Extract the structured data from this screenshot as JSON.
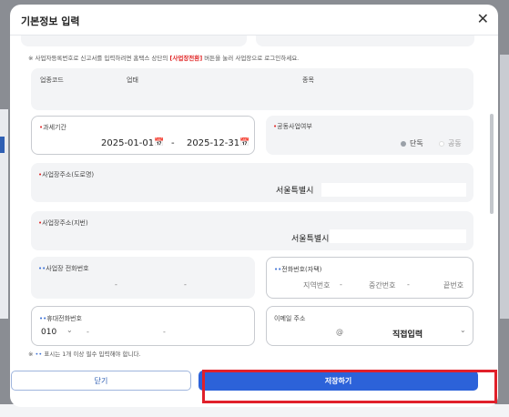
{
  "header": {
    "title": "기본정보 입력",
    "close_symbol": "✕"
  },
  "top_partial": {
    "left_value": "",
    "right_value": ""
  },
  "notice": {
    "prefix": "※ 사업자등록번호로 신고서를 입력하려면 홈택스 상단의 ",
    "highlight": "[사업장전환]",
    "suffix": " 버튼을 눌러 사업장으로 로그인하세요."
  },
  "business_info": {
    "code_label": "업종코드",
    "type_label": "업태",
    "item_label": "종목"
  },
  "tax_period": {
    "marker": "•",
    "label": "과세기간",
    "start": "2025-01-01",
    "separator": "-",
    "end": "2025-12-31",
    "calendar_icon": "calendar-icon"
  },
  "joint_business": {
    "marker": "•",
    "label": "공동사업여부",
    "option1": "단독",
    "option2": "공동",
    "selected": "단독"
  },
  "address_road": {
    "marker": "•",
    "label": "사업장주소(도로명)",
    "value": "서울특별시"
  },
  "address_lot": {
    "marker": "•",
    "label": "사업장주소(지번)",
    "value": "서울특별시"
  },
  "biz_phone": {
    "marker": "••",
    "label": "사업장 전화번호",
    "sep1": "-",
    "sep2": "-"
  },
  "home_phone": {
    "marker": "••",
    "label": "전화번호(자택)",
    "area": "지역번호",
    "mid": "중간번호",
    "last": "끝번호",
    "sep1": "-",
    "sep2": "-"
  },
  "mobile": {
    "marker": "••",
    "label": "휴대전화번호",
    "prefix": "010",
    "chevron": "⌄",
    "sep1": "-",
    "sep2": "-"
  },
  "email": {
    "label": "이메일 주소",
    "at": "@",
    "domain_select": "직접입력",
    "chevron": "⌄"
  },
  "footnote": {
    "prefix": "※ ",
    "marker": "••",
    "text": " 표시는 1개 이상 필수 입력해야 합니다."
  },
  "footer": {
    "close_label": "닫기",
    "save_label": "저장하기"
  },
  "colors": {
    "accent": "#2c62d9",
    "required": "#e02424",
    "highlight_box": "#e0202a"
  }
}
